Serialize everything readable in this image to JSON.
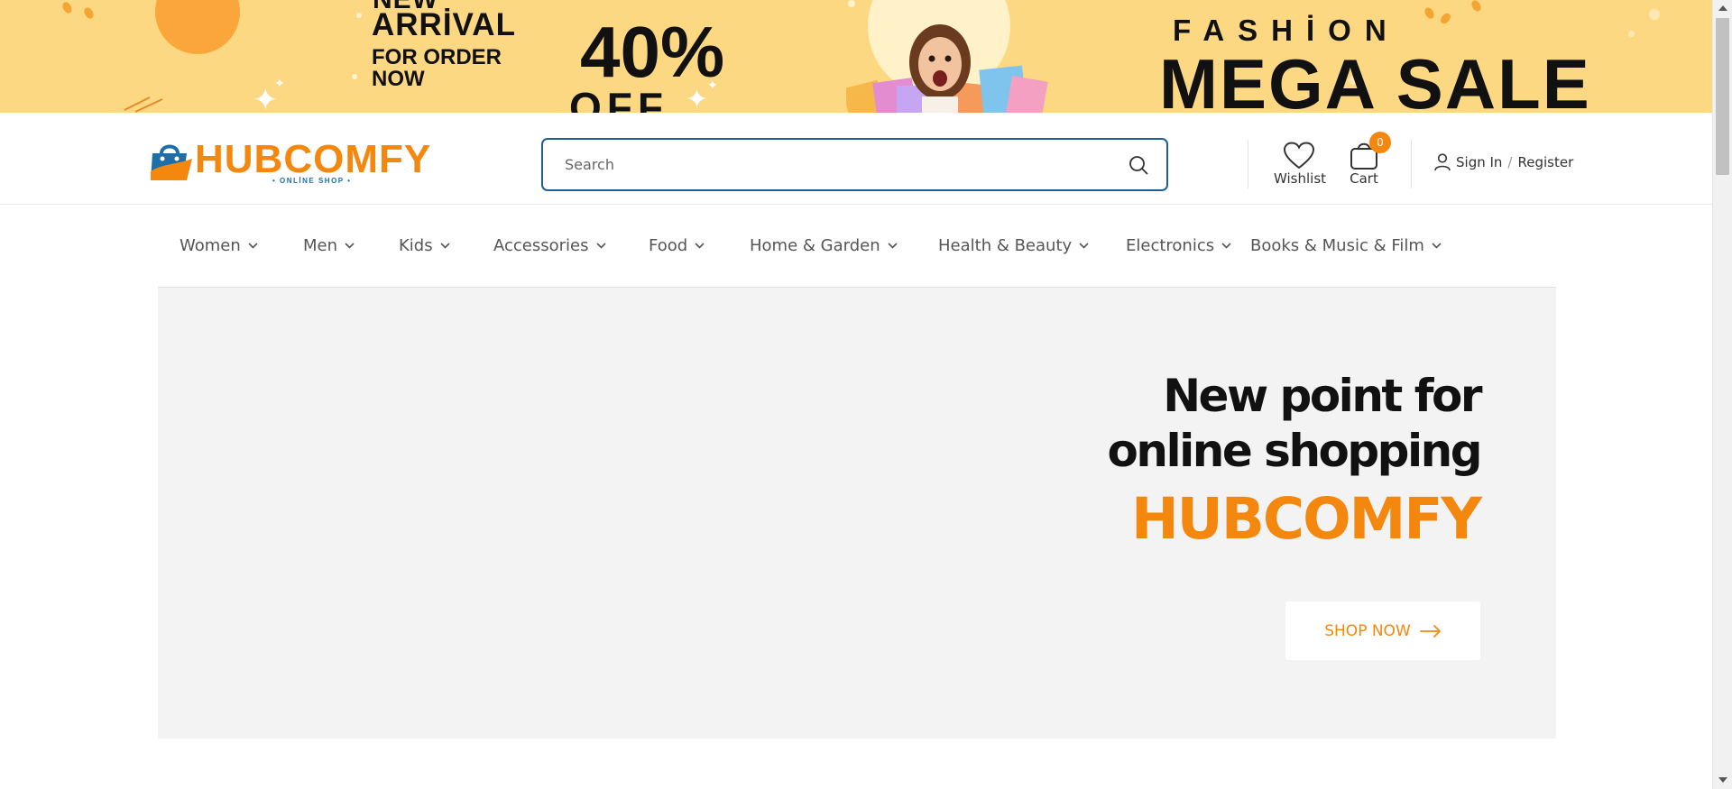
{
  "banner": {
    "new": "NEW",
    "arrival": "ARRİVAL",
    "for_order_now": "FOR ORDER NOW",
    "percent": "40%",
    "off": "OFF",
    "fashion": "FASHİON",
    "mega_sale": "MEGA SALE"
  },
  "header": {
    "logo_text": "HUBCOMFY",
    "logo_subtitle": "• ONLİNE SHOP •",
    "search_placeholder": "Search",
    "wishlist_label": "Wishlist",
    "cart_label": "Cart",
    "cart_count": "0",
    "sign_in": "Sign In",
    "separator": "/",
    "register": "Register"
  },
  "nav": {
    "items": [
      {
        "label": "Women"
      },
      {
        "label": "Men"
      },
      {
        "label": "Kids"
      },
      {
        "label": "Accessories"
      },
      {
        "label": "Food"
      },
      {
        "label": "Home & Garden"
      },
      {
        "label": "Health & Beauty"
      },
      {
        "label": "Electronics"
      },
      {
        "label": "Books & Music & Film"
      }
    ]
  },
  "hero": {
    "line1": "New point for",
    "line2": "online shopping",
    "brand": "HUBCOMFY",
    "button_label": "SHOP NOW"
  },
  "colors": {
    "accent": "#f4870e",
    "search_border": "#1d5e99",
    "banner_bg": "#fcd882",
    "hero_bg": "#f3f3f3"
  },
  "icons": [
    "shopping-bag-logo-icon",
    "search-icon",
    "heart-icon",
    "cart-bag-icon",
    "user-icon",
    "chevron-down-icon",
    "arrow-right-icon"
  ]
}
